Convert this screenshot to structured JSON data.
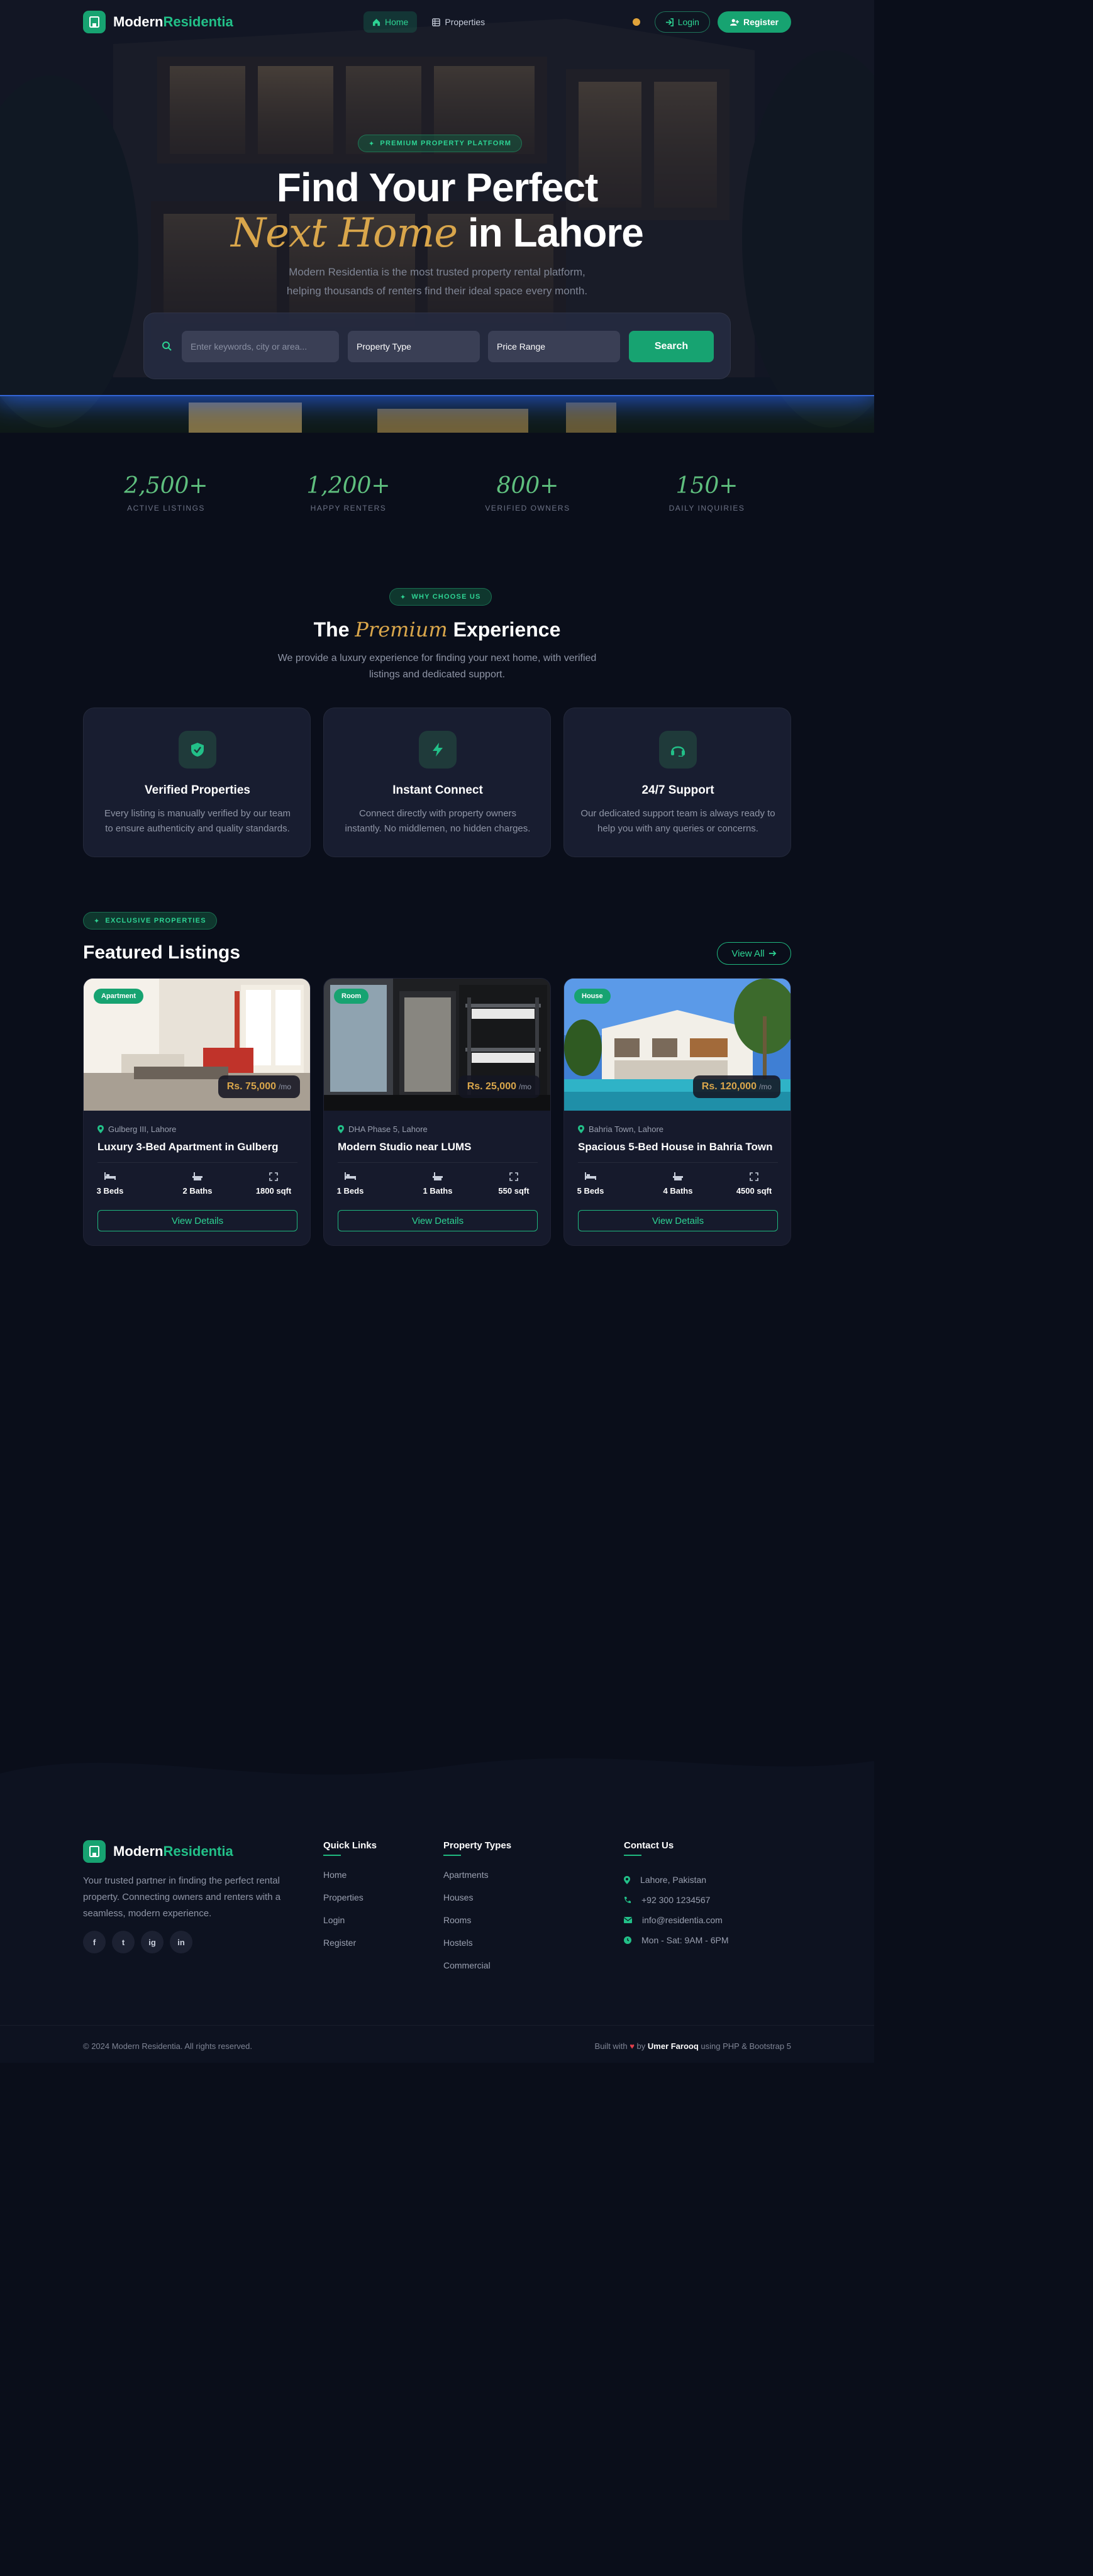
{
  "nav": {
    "brand_primary": "Modern",
    "brand_accent": "Residentia",
    "links": [
      {
        "label": "Home",
        "icon": "home-icon",
        "active": true
      },
      {
        "label": "Properties",
        "icon": "grid-icon",
        "active": false
      }
    ],
    "login_label": "Login",
    "register_label": "Register"
  },
  "hero": {
    "pill": "PREMIUM PROPERTY PLATFORM",
    "title_line1": "Find Your Perfect",
    "title_highlight": "Next Home",
    "title_rest": " in Lahore",
    "subtitle_line1": "Modern Residentia is the most trusted property rental platform,",
    "subtitle_line2": "helping thousands of renters find their ideal space every month."
  },
  "search": {
    "keyword_placeholder": "Enter keywords, city or area...",
    "type_value": "Property Type",
    "price_value": "Price Range",
    "button_label": "Search"
  },
  "stats": [
    {
      "value": "2,500+",
      "label": "ACTIVE LISTINGS"
    },
    {
      "value": "1,200+",
      "label": "HAPPY RENTERS"
    },
    {
      "value": "800+",
      "label": "VERIFIED OWNERS"
    },
    {
      "value": "150+",
      "label": "DAILY INQUIRIES"
    }
  ],
  "why": {
    "pill": "WHY CHOOSE US",
    "title_pre": "The ",
    "title_highlight": "Premium",
    "title_post": " Experience",
    "subtitle": "We provide a luxury experience for finding your next home, with verified listings and dedicated support.",
    "features": [
      {
        "icon": "shield-check-icon",
        "title": "Verified Properties",
        "desc": "Every listing is manually verified by our team to ensure authenticity and quality standards."
      },
      {
        "icon": "lightning-icon",
        "title": "Instant Connect",
        "desc": "Connect directly with property owners instantly. No middlemen, no hidden charges."
      },
      {
        "icon": "headset-icon",
        "title": "24/7 Support",
        "desc": "Our dedicated support team is always ready to help you with any queries or concerns."
      }
    ]
  },
  "listings": {
    "pill": "EXCLUSIVE PROPERTIES",
    "title": "Featured Listings",
    "view_all": "View All",
    "cards": [
      {
        "badge": "Apartment",
        "price": "Rs. 75,000",
        "per": "/mo",
        "location": "Gulberg III, Lahore",
        "title": "Luxury 3-Bed Apartment in Gulberg",
        "beds": "3 Beds",
        "baths": "2 Baths",
        "area": "1800 sqft",
        "button": "View Details"
      },
      {
        "badge": "Room",
        "price": "Rs. 25,000",
        "per": "/mo",
        "location": "DHA Phase 5, Lahore",
        "title": "Modern Studio near LUMS",
        "beds": "1 Beds",
        "baths": "1 Baths",
        "area": "550 sqft",
        "button": "View Details"
      },
      {
        "badge": "House",
        "price": "Rs. 120,000",
        "per": "/mo",
        "location": "Bahria Town, Lahore",
        "title": "Spacious 5-Bed House in Bahria Town",
        "beds": "5 Beds",
        "baths": "4 Baths",
        "area": "4500 sqft",
        "button": "View Details"
      }
    ]
  },
  "footer": {
    "about": "Your trusted partner in finding the perfect rental property. Connecting owners and renters with a seamless, modern experience.",
    "socials": [
      "f",
      "t",
      "ig",
      "in"
    ],
    "quick_links_title": "Quick Links",
    "quick_links": [
      "Home",
      "Properties",
      "Login",
      "Register"
    ],
    "types_title": "Property Types",
    "types": [
      "Apartments",
      "Houses",
      "Rooms",
      "Hostels",
      "Commercial"
    ],
    "contact_title": "Contact Us",
    "contact": [
      {
        "icon": "map-pin-icon",
        "text": "Lahore, Pakistan"
      },
      {
        "icon": "phone-icon",
        "text": "+92 300 1234567"
      },
      {
        "icon": "mail-icon",
        "text": "info@residentia.com"
      },
      {
        "icon": "clock-icon",
        "text": "Mon - Sat: 9AM - 6PM"
      }
    ],
    "copyright": "© 2024 Modern Residentia. All rights reserved.",
    "built_pre": "Built with",
    "built_by": "by",
    "built_author": "Umer Farooq",
    "built_post": "using PHP & Bootstrap 5"
  },
  "colors": {
    "accent": "#17a371",
    "gold": "#d9a64b",
    "background": "#0a0e1a"
  }
}
